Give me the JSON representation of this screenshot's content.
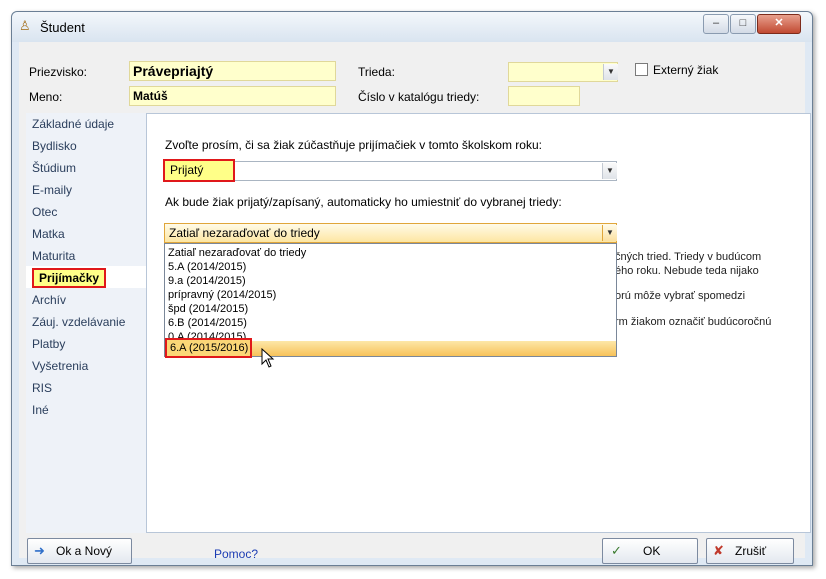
{
  "window": {
    "title": "Študent",
    "icon": "student-icon"
  },
  "header": {
    "priezvisko_label": "Priezvisko:",
    "priezvisko_value": "Právepriajtý",
    "meno_label": "Meno:",
    "meno_value": "Matúš",
    "trieda_label": "Trieda:",
    "trieda_value": "",
    "katalog_label": "Číslo v katalógu triedy:",
    "katalog_value": "",
    "externy_label": "Externý žiak"
  },
  "sidebar": {
    "items": [
      {
        "label": "Základné údaje"
      },
      {
        "label": "Bydlisko"
      },
      {
        "label": "Štúdium"
      },
      {
        "label": "E-maily"
      },
      {
        "label": "Otec"
      },
      {
        "label": "Matka"
      },
      {
        "label": "Maturita"
      },
      {
        "label": "Prijímačky"
      },
      {
        "label": "Archív"
      },
      {
        "label": "Záuj. vzdelávanie"
      },
      {
        "label": "Platby"
      },
      {
        "label": "Vyšetrenia"
      },
      {
        "label": "RIS"
      },
      {
        "label": "Iné"
      }
    ]
  },
  "main": {
    "question1": "Zvoľte prosím, či sa žiak zúčastňuje prijímačiek v tomto školskom roku:",
    "prijatie_value": "Prijatý",
    "question2": "Ak bude žiak prijatý/zapísaný, automaticky ho umiestniť do vybranej triedy:",
    "trieda_select_value": "Zatiaľ nezaraďovať do triedy",
    "dropdown_options": [
      "Zatiaľ nezaraďovať do triedy",
      "5.A (2014/2015)",
      "9.a (2014/2015)",
      "prípravný (2014/2015)",
      "špd (2014/2015)",
      "6.B (2014/2015)",
      "0.A (2014/2015)",
      "6.A (2015/2016)"
    ],
    "bg_text_1a": "čných tried. Triedy v budúcom",
    "bg_text_1b": "ého roku. Nebude teda nijako",
    "bg_text_2": "orú môže vybrať spomedzi",
    "bg_text_3": "rm žiakom označiť budúcoročnú"
  },
  "footer": {
    "ok_new_label": "Ok a Nový",
    "help_label": "Pomoc?",
    "ok_label": "OK",
    "cancel_label": "Zrušiť"
  }
}
